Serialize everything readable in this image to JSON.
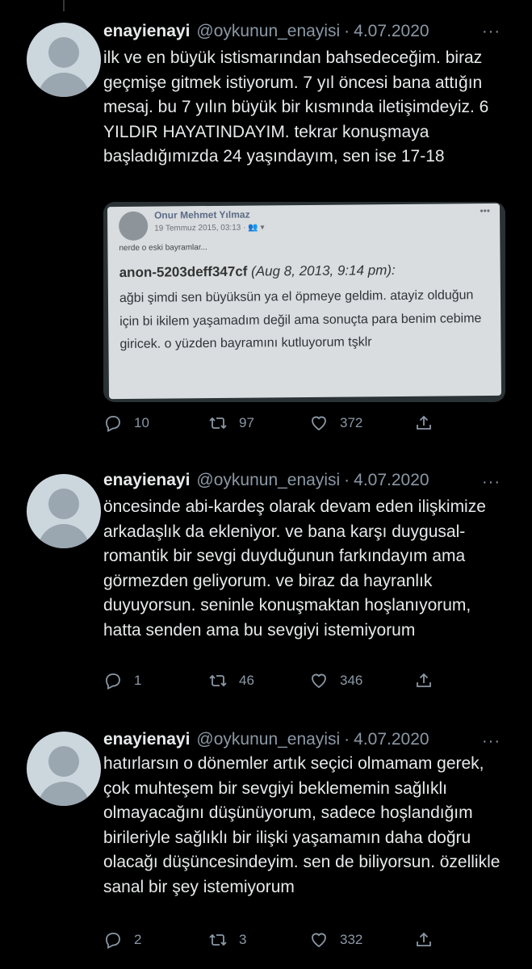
{
  "tweets": [
    {
      "name": "enayienayi",
      "handle": "@oykunun_enayisi",
      "separator": "·",
      "date": "4.07.2020",
      "more": "···",
      "text": "ilk ve en büyük istismarından bahsedeceğim. biraz geçmişe gitmek istiyorum. 7 yıl öncesi bana attığın mesaj. bu 7 yılın büyük bir kısmında iletişimdeyiz. 6 YILDIR HAYATINDAYIM. tekrar konuşmaya başladığımızda 24 yaşındayım, sen ise 17-18",
      "media": {
        "name": "Onur Mehmet Yılmaz",
        "date": "19 Temmuz 2015, 03:13 · 👥 ▾",
        "menu": "•••",
        "caption": "nerde o eski bayramlar...",
        "anon_id": "anon-5203deff347cf",
        "anon_time": " (Aug 8, 2013, 9:14 pm):",
        "message": "ağbi şimdi sen büyüksün ya el öpmeye geldim. atayiz olduğun için bi ikilem yaşamadım değil ama sonuçta para benim cebime giricek. o yüzden bayramını kutluyorum tşklr"
      },
      "replies": "10",
      "retweets": "97",
      "likes": "372"
    },
    {
      "name": "enayienayi",
      "handle": "@oykunun_enayisi",
      "separator": "·",
      "date": "4.07.2020",
      "more": "···",
      "text": "öncesinde abi-kardeş olarak devam eden ilişkimize arkadaşlık da ekleniyor. ve bana karşı duygusal-romantik bir sevgi duyduğunun farkındayım ama görmezden geliyorum. ve biraz da hayranlık duyuyorsun. seninle konuşmaktan hoşlanıyorum, hatta senden ama bu sevgiyi istemiyorum",
      "replies": "1",
      "retweets": "46",
      "likes": "346"
    },
    {
      "name": "enayienayi",
      "handle": "@oykunun_enayisi",
      "separator": "·",
      "date": "4.07.2020",
      "more": "···",
      "text": "hatırlarsın o dönemler artık seçici olmamam gerek, çok muhteşem bir sevgiyi beklememin sağlıklı olmayacağını düşünüyorum, sadece hoşlandığım birileriyle sağlıklı bir ilişki yaşamamın daha doğru olacağı düşüncesindeyim. sen de biliyorsun. özellikle sanal bir şey istemiyorum",
      "replies": "2",
      "retweets": "3",
      "likes": "332"
    }
  ]
}
